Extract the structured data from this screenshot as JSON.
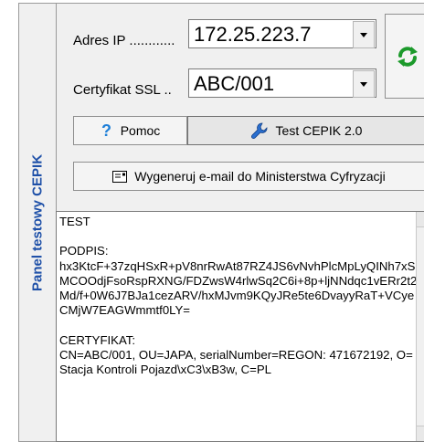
{
  "side_tab": {
    "label": "Panel testowy CEPIK"
  },
  "ip": {
    "label": "Adres IP ............",
    "value": "172.25.223.7"
  },
  "ssl": {
    "label": "Certyfikat SSL ..",
    "value": "ABC/001"
  },
  "buttons": {
    "help": "Pomoc",
    "test": "Test CEPIK 2.0",
    "email": "Wygeneruj e-mail do Ministerstwa Cyfryzacji"
  },
  "log": {
    "text": "TEST\n\nPODPIS:\nhx3KtcF+37zqHSxR+pV8nrRwAt87RZ4JS6vNvhPlcMpLyQINh7xSMCOOdjFsoRspRXNG/FDZwsW4rlwSq2C6i+8p+ljNNdqc1vERr2t2Md/f+0W6J7BJa1cezARV/hxMJvm9KQyJRe5te6DvayyRaT+VCyeCMjW7EAGWmmtf0LY=\n\nCERTYFIKAT:\nCN=ABC/001, OU=JAPA, serialNumber=REGON: 471672192, O=Stacja Kontroli Pojazd\\xC3\\xB3w, C=PL"
  },
  "colors": {
    "side_label": "#1e50a8",
    "help_icon": "#1e7fd8",
    "refresh_icon": "#1c9a2b",
    "wrench_icon": "#2a6fd0"
  },
  "icons": {
    "refresh": "refresh-icon",
    "help": "question-icon",
    "test": "wrench-icon",
    "email": "email-icon"
  }
}
